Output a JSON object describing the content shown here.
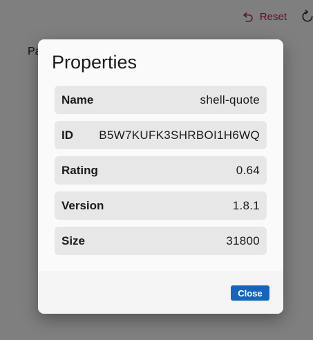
{
  "background": {
    "toolbar": {
      "reset_label": "Reset",
      "reset_icon": "undo-icon",
      "refresh_icon": "refresh-icon"
    },
    "content_label": "Pa"
  },
  "dialog": {
    "title": "Properties",
    "properties": [
      {
        "key": "Name",
        "value": "shell-quote"
      },
      {
        "key": "ID",
        "value": "B5W7KUFK3SHRBOI1H6WQ"
      },
      {
        "key": "Rating",
        "value": "0.64"
      },
      {
        "key": "Version",
        "value": "1.8.1"
      },
      {
        "key": "Size",
        "value": "31800"
      }
    ],
    "close_label": "Close"
  },
  "colors": {
    "accent": "#1565c0",
    "reset": "#c2185b",
    "overlay": "rgba(0,0,0,0.5)"
  }
}
